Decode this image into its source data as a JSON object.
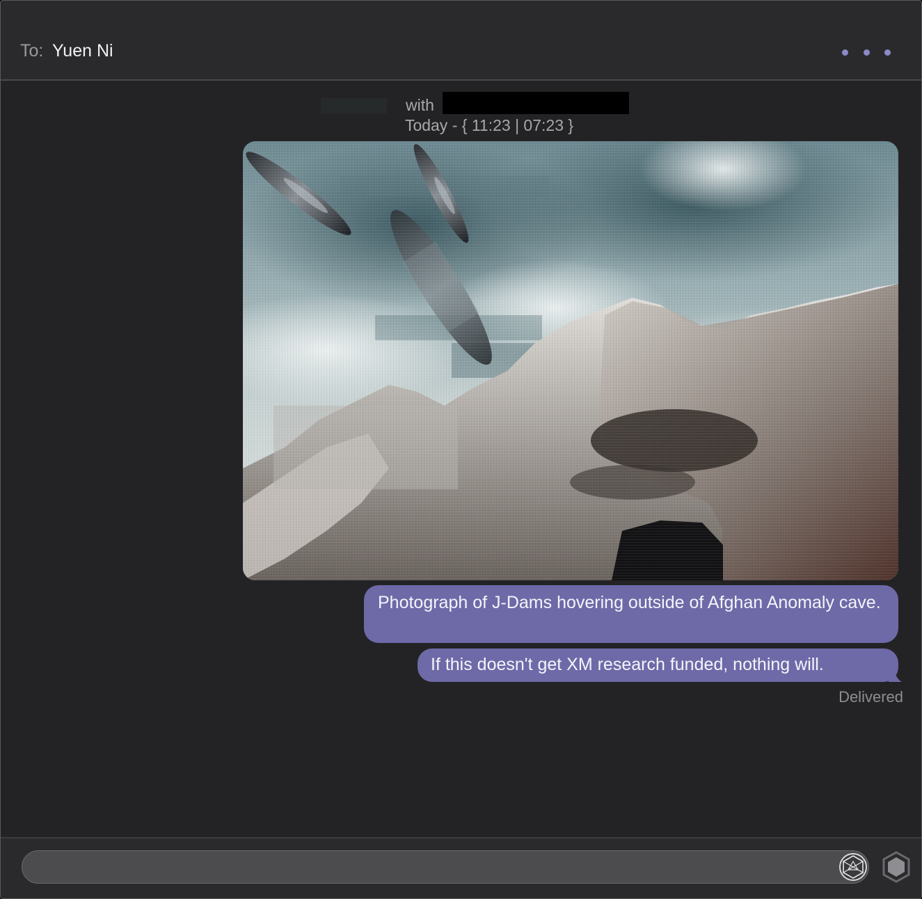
{
  "header": {
    "to_label": "To:",
    "recipient": "Yuen Ni",
    "more_icon": "ellipsis-icon"
  },
  "thread": {
    "with_label": "with",
    "timestamp": "Today - { 11:23 | 07:23 }"
  },
  "messages": [
    {
      "type": "image",
      "icon": "photo-attachment"
    },
    {
      "type": "text",
      "text": "Photograph of J-Dams hovering outside of Afghan Anomaly cave."
    },
    {
      "type": "text",
      "text": "If this doesn't get XM research funded, nothing will."
    }
  ],
  "status": "Delivered",
  "compose": {
    "placeholder": "",
    "glyph_icon": "glyph-sphere-icon",
    "send_icon": "hexagon-send-icon"
  },
  "colors": {
    "bubble": "#6e6aa8",
    "accent": "#8a8ac8",
    "background": "#232325"
  }
}
